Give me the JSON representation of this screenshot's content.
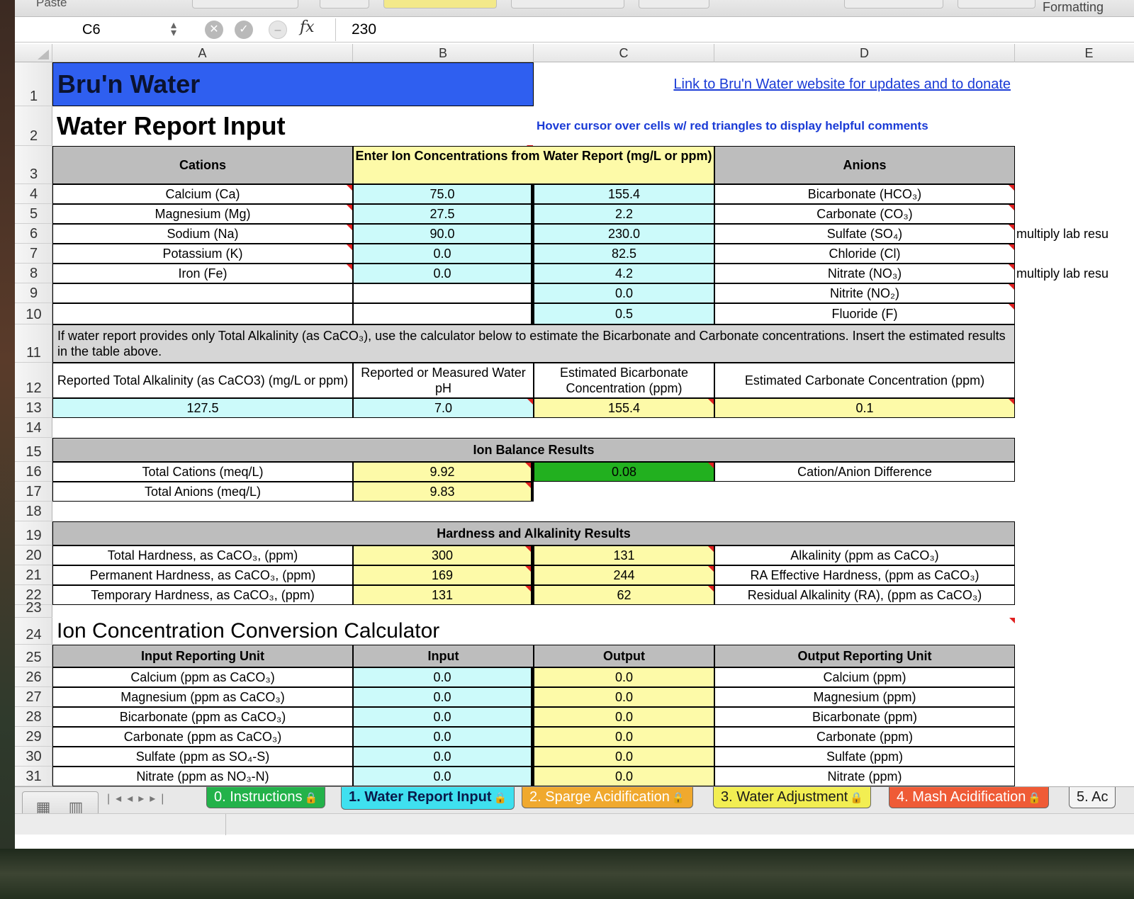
{
  "ribbon": {
    "paste_label": "Paste",
    "formatting_label": "Formatting"
  },
  "formula_bar": {
    "cell_ref": "C6",
    "formula": "230",
    "fx_label": "fx"
  },
  "columns": [
    "A",
    "B",
    "C",
    "D",
    "E"
  ],
  "rows": [
    "1",
    "2",
    "3",
    "4",
    "5",
    "6",
    "7",
    "8",
    "9",
    "10",
    "11",
    "12",
    "13",
    "14",
    "15",
    "16",
    "17",
    "18",
    "19",
    "20",
    "21",
    "22",
    "23",
    "24",
    "25",
    "26",
    "27",
    "28",
    "29",
    "30",
    "31"
  ],
  "sheet": {
    "title": "Bru'n Water",
    "link": "Link to Bru'n Water website for updates and to donate",
    "subtitle": "Water Report Input",
    "hover_note": "Hover cursor over cells w/ red triangles to display helpful comments",
    "ion_header": {
      "cations": "Cations",
      "enter": "Enter Ion Concentrations from Water Report     (mg/L or ppm)",
      "anions": "Anions"
    },
    "ions": [
      {
        "cation": "Calcium (Ca)",
        "cation_value": "75.0",
        "anion_value": "155.4",
        "anion": "Bicarbonate (HCO₃)",
        "note": ""
      },
      {
        "cation": "Magnesium (Mg)",
        "cation_value": "27.5",
        "anion_value": "2.2",
        "anion": "Carbonate (CO₃)",
        "note": ""
      },
      {
        "cation": "Sodium (Na)",
        "cation_value": "90.0",
        "anion_value": "230.0",
        "anion": "Sulfate (SO₄)",
        "note": "multiply lab resu"
      },
      {
        "cation": "Potassium (K)",
        "cation_value": "0.0",
        "anion_value": "82.5",
        "anion": "Chloride (Cl)",
        "note": ""
      },
      {
        "cation": "Iron (Fe)",
        "cation_value": "0.0",
        "anion_value": "4.2",
        "anion": "Nitrate (NO₃)",
        "note": "multiply lab resu"
      },
      {
        "cation": "",
        "cation_value": "",
        "anion_value": "0.0",
        "anion": "Nitrite (NO₂)",
        "note": ""
      },
      {
        "cation": "",
        "cation_value": "",
        "anion_value": "0.5",
        "anion": "Fluoride (F)",
        "note": ""
      }
    ],
    "alkalinity_note": "If water report provides only Total Alkalinity (as CaCO₃), use the calculator below to estimate the Bicarbonate and Carbonate concentrations.  Insert the estimated results in the table above.",
    "alk_calc": {
      "headers": [
        "Reported Total Alkalinity (as CaCO3) (mg/L or ppm)",
        "Reported or Measured Water pH",
        "Estimated Bicarbonate Concentration (ppm)",
        "Estimated Carbonate Concentration (ppm)"
      ],
      "values": [
        "127.5",
        "7.0",
        "155.4",
        "0.1"
      ]
    },
    "ion_balance": {
      "title": "Ion Balance Results",
      "total_cations_label": "Total Cations (meq/L)",
      "total_cations": "9.92",
      "difference": "0.08",
      "difference_label": "Cation/Anion Difference",
      "total_anions_label": "Total Anions (meq/L)",
      "total_anions": "9.83"
    },
    "hardness": {
      "title": "Hardness and Alkalinity Results",
      "rows": [
        {
          "label": "Total Hardness, as CaCO₃, (ppm)",
          "value": "300",
          "value2": "131",
          "label2": "Alkalinity (ppm as CaCO₃)"
        },
        {
          "label": "Permanent Hardness, as CaCO₃, (ppm)",
          "value": "169",
          "value2": "244",
          "label2": "RA Effective Hardness, (ppm as CaCO₃)"
        },
        {
          "label": "Temporary Hardness, as CaCO₃, (ppm)",
          "value": "131",
          "value2": "62",
          "label2": "Residual Alkalinity (RA), (ppm as CaCO₃)"
        }
      ]
    },
    "converter": {
      "title": "Ion Concentration Conversion Calculator",
      "headers": [
        "Input Reporting Unit",
        "Input",
        "Output",
        "Output Reporting Unit"
      ],
      "rows": [
        {
          "in_unit": "Calcium (ppm as CaCO₃)",
          "input": "0.0",
          "output": "0.0",
          "out_unit": "Calcium (ppm)"
        },
        {
          "in_unit": "Magnesium (ppm as CaCO₃)",
          "input": "0.0",
          "output": "0.0",
          "out_unit": "Magnesium (ppm)"
        },
        {
          "in_unit": "Bicarbonate (ppm as CaCO₃)",
          "input": "0.0",
          "output": "0.0",
          "out_unit": "Bicarbonate (ppm)"
        },
        {
          "in_unit": "Carbonate (ppm as CaCO₃)",
          "input": "0.0",
          "output": "0.0",
          "out_unit": "Carbonate (ppm)"
        },
        {
          "in_unit": "Sulfate (ppm as SO₄-S)",
          "input": "0.0",
          "output": "0.0",
          "out_unit": "Sulfate (ppm)"
        },
        {
          "in_unit": "Nitrate (ppm as NO₃-N)",
          "input": "0.0",
          "output": "0.0",
          "out_unit": "Nitrate (ppm)"
        }
      ]
    }
  },
  "tabs": [
    {
      "label": "0. Instructions",
      "color": "#23b24a",
      "text_color": "#ffffff",
      "locked": true
    },
    {
      "label": "1. Water Report Input",
      "color": "#3fe0ef",
      "text_color": "#0a1a4a",
      "locked": true,
      "active": true
    },
    {
      "label": "2. Sparge Acidification",
      "color": "#f0a92e",
      "text_color": "#ffffff",
      "locked": true
    },
    {
      "label": "3. Water Adjustment",
      "color": "#f2ee52",
      "text_color": "#1a1a1a",
      "locked": true
    },
    {
      "label": "4. Mash Acidification",
      "color": "#ef5b36",
      "text_color": "#ffffff",
      "locked": true
    },
    {
      "label": "5. Ac",
      "color": "#f4f4f4",
      "text_color": "#1a1a1a",
      "locked": false
    }
  ],
  "colors": {
    "title_bg": "#2f5ff0",
    "input_cyan": "#ccfafa",
    "output_yellow": "#fdfaa8",
    "header_gray": "#bdbdbd",
    "good_green": "#22b01f",
    "link_blue": "#1a3bd6",
    "comment_red": "#e02020"
  }
}
